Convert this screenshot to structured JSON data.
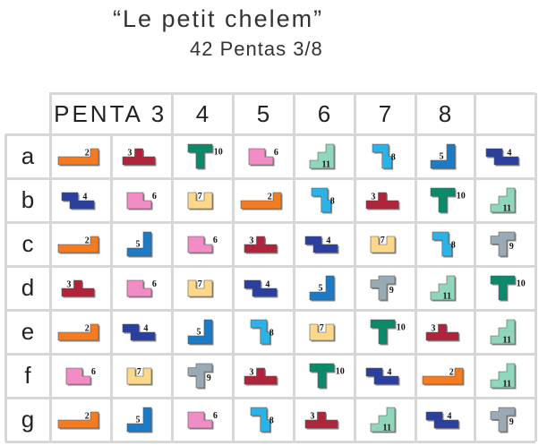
{
  "header": {
    "title": "“Le petit chelem”",
    "subtitle": "42 Pentas 3/8"
  },
  "table": {
    "first_column_label": "PENTA",
    "columns": [
      "3",
      "4",
      "5",
      "6",
      "7",
      "8"
    ],
    "rows": [
      {
        "label": "a",
        "cells": [
          {
            "shape": "corner",
            "num": "2",
            "color": "#f47b20"
          },
          {
            "shape": "sign",
            "num": "3",
            "color": "#b0243b"
          },
          {
            "shape": "T",
            "num": "10",
            "color": "#0a8a6a"
          },
          {
            "shape": "flag",
            "num": "6",
            "color": "#f28cc4"
          },
          {
            "shape": "stairs",
            "num": "11",
            "color": "#8fd6bb"
          },
          {
            "shape": "hook",
            "num": "8",
            "color": "#2bb3e8"
          },
          {
            "shape": "L",
            "num": "5",
            "color": "#1d7ac5"
          },
          {
            "shape": "Z",
            "num": "4",
            "color": "#2a3f9e"
          }
        ]
      },
      {
        "label": "b",
        "cells": [
          {
            "shape": "Z",
            "num": "4",
            "color": "#2a3f9e"
          },
          {
            "shape": "flag",
            "num": "6",
            "color": "#f28cc4"
          },
          {
            "shape": "cup",
            "num": "7",
            "color": "#fcd98a"
          },
          {
            "shape": "corner",
            "num": "2",
            "color": "#f47b20"
          },
          {
            "shape": "hook",
            "num": "8",
            "color": "#2bb3e8"
          },
          {
            "shape": "sign",
            "num": "3",
            "color": "#b0243b"
          },
          {
            "shape": "T",
            "num": "10",
            "color": "#0a8a6a"
          },
          {
            "shape": "stairs",
            "num": "11",
            "color": "#8fd6bb"
          }
        ]
      },
      {
        "label": "c",
        "cells": [
          {
            "shape": "corner",
            "num": "2",
            "color": "#f47b20"
          },
          {
            "shape": "L",
            "num": "5",
            "color": "#1d7ac5"
          },
          {
            "shape": "flag",
            "num": "6",
            "color": "#f28cc4"
          },
          {
            "shape": "sign",
            "num": "3",
            "color": "#b0243b"
          },
          {
            "shape": "Z",
            "num": "4",
            "color": "#2a3f9e"
          },
          {
            "shape": "cup",
            "num": "7",
            "color": "#fcd98a"
          },
          {
            "shape": "hook",
            "num": "8",
            "color": "#2bb3e8"
          },
          {
            "shape": "cross",
            "num": "9",
            "color": "#9aaab5"
          }
        ]
      },
      {
        "label": "d",
        "cells": [
          {
            "shape": "sign",
            "num": "3",
            "color": "#b0243b"
          },
          {
            "shape": "flag",
            "num": "6",
            "color": "#f28cc4"
          },
          {
            "shape": "cup",
            "num": "7",
            "color": "#fcd98a"
          },
          {
            "shape": "Z",
            "num": "4",
            "color": "#2a3f9e"
          },
          {
            "shape": "L",
            "num": "5",
            "color": "#1d7ac5"
          },
          {
            "shape": "cross",
            "num": "9",
            "color": "#9aaab5"
          },
          {
            "shape": "stairs",
            "num": "11",
            "color": "#8fd6bb"
          },
          {
            "shape": "T",
            "num": "10",
            "color": "#0a8a6a"
          }
        ]
      },
      {
        "label": "e",
        "cells": [
          {
            "shape": "corner",
            "num": "2",
            "color": "#f47b20"
          },
          {
            "shape": "Z",
            "num": "4",
            "color": "#2a3f9e"
          },
          {
            "shape": "L",
            "num": "5",
            "color": "#1d7ac5"
          },
          {
            "shape": "hook",
            "num": "8",
            "color": "#2bb3e8"
          },
          {
            "shape": "cup",
            "num": "7",
            "color": "#fcd98a"
          },
          {
            "shape": "T",
            "num": "10",
            "color": "#0a8a6a"
          },
          {
            "shape": "sign",
            "num": "3",
            "color": "#b0243b"
          },
          {
            "shape": "stairs",
            "num": "11",
            "color": "#8fd6bb"
          }
        ]
      },
      {
        "label": "f",
        "cells": [
          {
            "shape": "flag",
            "num": "6",
            "color": "#f28cc4"
          },
          {
            "shape": "cup",
            "num": "7",
            "color": "#fcd98a"
          },
          {
            "shape": "cross",
            "num": "9",
            "color": "#9aaab5"
          },
          {
            "shape": "sign",
            "num": "3",
            "color": "#b0243b"
          },
          {
            "shape": "T",
            "num": "10",
            "color": "#0a8a6a"
          },
          {
            "shape": "Z",
            "num": "4",
            "color": "#2a3f9e"
          },
          {
            "shape": "corner",
            "num": "2",
            "color": "#f47b20"
          },
          {
            "shape": "stairs",
            "num": "11",
            "color": "#8fd6bb"
          }
        ]
      },
      {
        "label": "g",
        "cells": [
          {
            "shape": "corner",
            "num": "2",
            "color": "#f47b20"
          },
          {
            "shape": "L",
            "num": "5",
            "color": "#1d7ac5"
          },
          {
            "shape": "flag",
            "num": "6",
            "color": "#f28cc4"
          },
          {
            "shape": "hook",
            "num": "8",
            "color": "#2bb3e8"
          },
          {
            "shape": "sign",
            "num": "3",
            "color": "#b0243b"
          },
          {
            "shape": "stairs",
            "num": "11",
            "color": "#8fd6bb"
          },
          {
            "shape": "Z",
            "num": "4",
            "color": "#2a3f9e"
          },
          {
            "shape": "cross",
            "num": "9",
            "color": "#9aaab5"
          }
        ]
      }
    ]
  }
}
